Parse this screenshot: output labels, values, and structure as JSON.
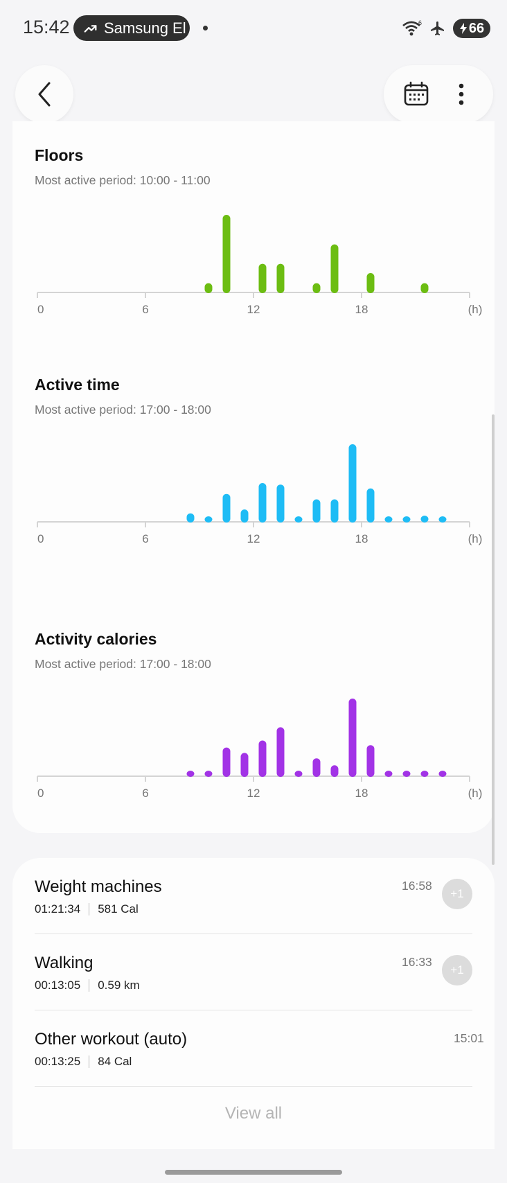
{
  "status_bar": {
    "time": "15:42",
    "notification_label": "Samsung El",
    "battery_level": "66"
  },
  "nav": {
    "back_icon": "chevron-left-icon",
    "calendar_icon": "calendar-icon",
    "more_icon": "more-vertical-icon"
  },
  "charts": [
    {
      "title": "Floors",
      "subtitle": "Most active period: 10:00 - 11:00",
      "color": "#6cbd12",
      "unit": "(h)",
      "x_ticks": [
        "0",
        "6",
        "12",
        "18"
      ],
      "values": [
        0,
        0,
        0,
        0,
        0,
        0,
        0,
        0,
        0,
        0.12,
        1.0,
        0,
        0.37,
        0.37,
        0,
        0.12,
        0.62,
        0,
        0.25,
        0,
        0,
        0.12,
        0,
        0
      ]
    },
    {
      "title": "Active time",
      "subtitle": "Most active period: 17:00 - 18:00",
      "color": "#1ebcf5",
      "unit": "(h)",
      "x_ticks": [
        "0",
        "6",
        "12",
        "18"
      ],
      "values": [
        0,
        0,
        0,
        0,
        0,
        0,
        0,
        0,
        0.11,
        0.06,
        0.36,
        0.16,
        0.5,
        0.48,
        0.04,
        0.29,
        0.29,
        1.0,
        0.43,
        0.06,
        0.04,
        0.08,
        0.04,
        0
      ]
    },
    {
      "title": "Activity calories",
      "subtitle": "Most active period: 17:00 - 18:00",
      "color": "#a233e6",
      "unit": "(h)",
      "x_ticks": [
        "0",
        "6",
        "12",
        "18"
      ],
      "values": [
        0,
        0,
        0,
        0,
        0,
        0,
        0,
        0,
        0.05,
        0.05,
        0.37,
        0.3,
        0.46,
        0.63,
        0.04,
        0.23,
        0.14,
        1.0,
        0.4,
        0.04,
        0.04,
        0.04,
        0.04,
        0
      ]
    }
  ],
  "workouts": [
    {
      "name": "Weight machines",
      "duration": "01:21:34",
      "detail": "581 Cal",
      "time": "16:58",
      "badge": "+1"
    },
    {
      "name": "Walking",
      "duration": "00:13:05",
      "detail": "0.59 km",
      "time": "16:33",
      "badge": "+1"
    },
    {
      "name": "Other workout (auto)",
      "duration": "00:13:25",
      "detail": "84 Cal",
      "time": "15:01",
      "badge": ""
    }
  ],
  "view_all_label": "View all"
}
